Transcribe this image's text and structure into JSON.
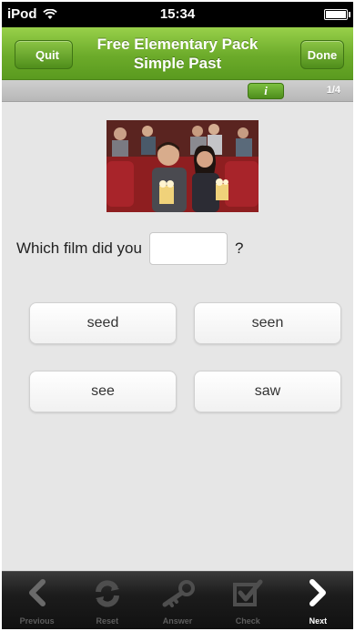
{
  "status_bar": {
    "carrier": "iPod",
    "time": "15:34"
  },
  "nav": {
    "title_line1": "Free Elementary Pack",
    "title_line2": "Simple Past",
    "quit_label": "Quit",
    "done_label": "Done"
  },
  "info_bar": {
    "info_label": "i",
    "page": "1/4"
  },
  "question": {
    "text_before": "Which film did you",
    "text_after": "?",
    "answer_value": ""
  },
  "options": [
    "seed",
    "seen",
    "see",
    "saw"
  ],
  "toolbar": {
    "items": [
      {
        "label": "Previous",
        "icon": "chevron-left-icon"
      },
      {
        "label": "Reset",
        "icon": "reset-icon"
      },
      {
        "label": "Answer",
        "icon": "key-icon"
      },
      {
        "label": "Check",
        "icon": "check-icon"
      },
      {
        "label": "Next",
        "icon": "chevron-right-icon"
      }
    ]
  },
  "colors": {
    "accent": "#6cab2a",
    "background": "#e6e6e6"
  }
}
